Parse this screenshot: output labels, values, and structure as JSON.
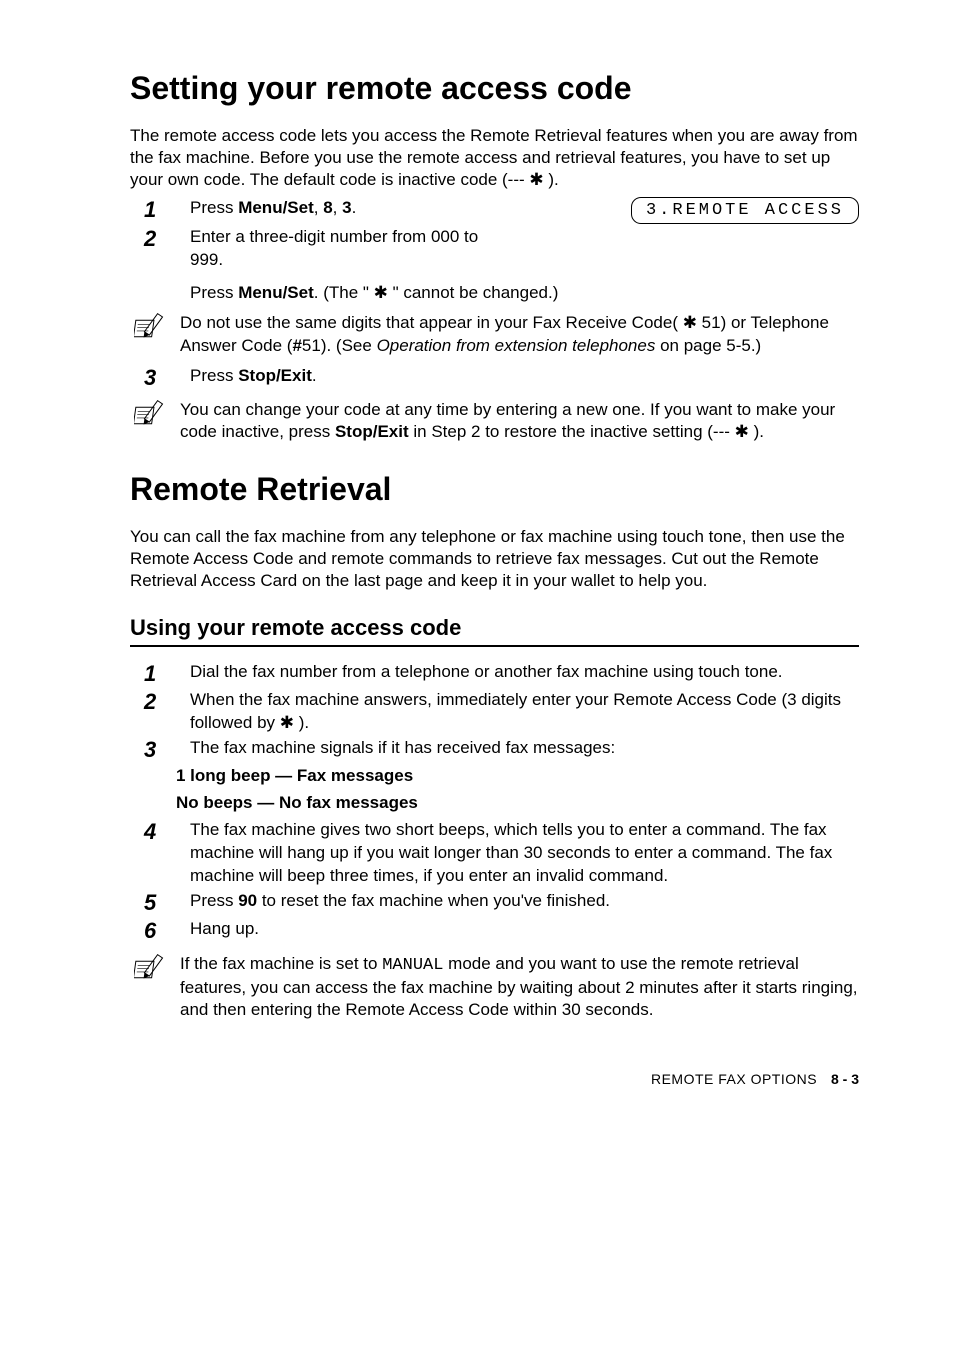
{
  "section1": {
    "heading": "Setting your remote access code",
    "intro": "The remote access code lets you access the Remote Retrieval features when you are away from the fax machine. Before you use the remote access and retrieval features, you have to set up your own code. The default code is inactive code (--- ✱ ).",
    "step1_num": "1",
    "step1_a": "Press ",
    "step1_b": "Menu/Set",
    "step1_c": ", ",
    "step1_d": "8",
    "step1_e": ", ",
    "step1_f": "3",
    "step1_g": ".",
    "lcd": "3.REMOTE ACCESS",
    "step2_num": "2",
    "step2_a": "Enter a three-digit number from 000 to 999.",
    "step2_b1": "Press ",
    "step2_b2": "Menu/Set",
    "step2_b3": ". (The \" ✱ \" cannot be changed.)",
    "note1_a": "Do not use the same digits that appear in your Fax Receive Code( ✱ 51) or Telephone Answer Code (",
    "note1_b": "#",
    "note1_c": "51). (See ",
    "note1_d": "Operation from extension telephones",
    "note1_e": " on page 5-5.)",
    "step3_num": "3",
    "step3_a": "Press ",
    "step3_b": "Stop/Exit",
    "step3_c": ".",
    "note2_a": "You can change your code at any time by entering a new one. If you want to make your code inactive, press ",
    "note2_b": "Stop/Exit",
    "note2_c": " in Step 2 to restore the inactive setting (--- ✱ )."
  },
  "section2": {
    "heading": "Remote Retrieval",
    "intro": "You can call the fax machine from any telephone or fax machine using touch tone, then use the Remote Access Code and remote commands to retrieve fax messages. Cut out the Remote Retrieval Access Card on the last page and keep it in your wallet to help you.",
    "subhead": "Using your remote access code",
    "step1_num": "1",
    "step1": "Dial the fax number from a telephone or another fax machine using touch tone.",
    "step2_num": "2",
    "step2": "When the fax machine answers, immediately enter your Remote Access Code (3 digits followed by ✱ ).",
    "step3_num": "3",
    "step3": "The fax machine signals if it has received fax messages:",
    "sig1": "1 long beep — Fax messages",
    "sig2": "No beeps — No fax messages",
    "step4_num": "4",
    "step4": "The fax machine gives two short beeps, which tells you to enter a command. The fax machine will hang up if you wait longer than 30 seconds to enter a command. The fax machine will beep three times, if you enter an invalid command.",
    "step5_num": "5",
    "step5_a": "Press ",
    "step5_b": "90",
    "step5_c": " to reset the fax machine when you've finished.",
    "step6_num": "6",
    "step6": "Hang up.",
    "note_a": "If the fax machine is set to ",
    "note_b": "MANUAL",
    "note_c": " mode and you want to use the remote retrieval features, you can access the fax machine by waiting about 2 minutes after it starts ringing, and then entering the Remote Access Code within 30 seconds."
  },
  "footer": {
    "chapter": "REMOTE FAX OPTIONS",
    "page": "8 - 3"
  }
}
